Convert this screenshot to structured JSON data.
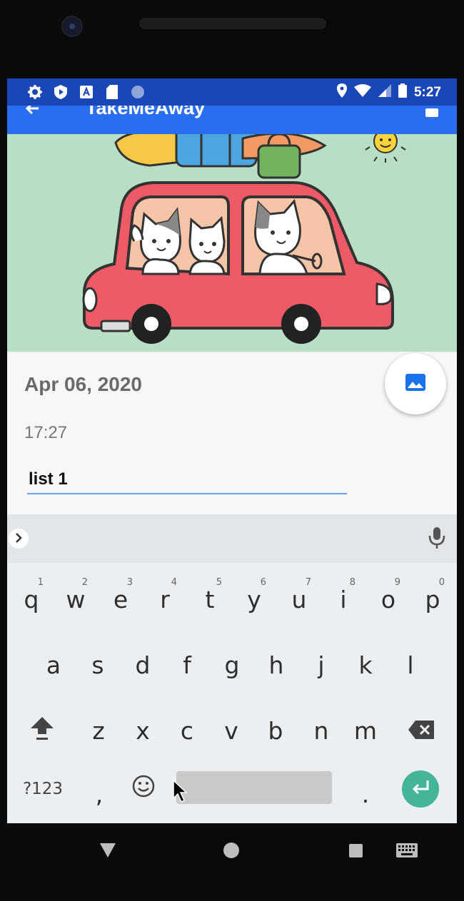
{
  "status_bar": {
    "time": "5:27",
    "left_icons": [
      "settings-icon",
      "play-protect-icon",
      "text-icon",
      "sd-card-icon",
      "circle-icon"
    ],
    "right_icons": [
      "location-icon",
      "wifi-icon",
      "signal-icon",
      "battery-icon"
    ]
  },
  "app_bar": {
    "title": "TakeMeAway",
    "back_icon": "back-arrow-icon",
    "action_icon": "save-icon",
    "color": "#2a6ef0"
  },
  "entry": {
    "date": "Apr 06, 2020",
    "time": "17:27",
    "list_value": "list 1",
    "fab_icon": "image-icon"
  },
  "keyboard": {
    "row1": [
      {
        "key": "q",
        "num": "1"
      },
      {
        "key": "w",
        "num": "2"
      },
      {
        "key": "e",
        "num": "3"
      },
      {
        "key": "r",
        "num": "4"
      },
      {
        "key": "t",
        "num": "5"
      },
      {
        "key": "y",
        "num": "6"
      },
      {
        "key": "u",
        "num": "7"
      },
      {
        "key": "i",
        "num": "8"
      },
      {
        "key": "o",
        "num": "9"
      },
      {
        "key": "p",
        "num": "0"
      }
    ],
    "row2": [
      "a",
      "s",
      "d",
      "f",
      "g",
      "h",
      "j",
      "k",
      "l"
    ],
    "row3": [
      "z",
      "x",
      "c",
      "v",
      "b",
      "n",
      "m"
    ],
    "symbols_label": "?123",
    "comma": ",",
    "period": ".",
    "accent": "#45b59a"
  },
  "nav_bar": {
    "icons": [
      "back-triangle-icon",
      "home-circle-icon",
      "recents-square-icon",
      "keyboard-switch-icon"
    ]
  }
}
